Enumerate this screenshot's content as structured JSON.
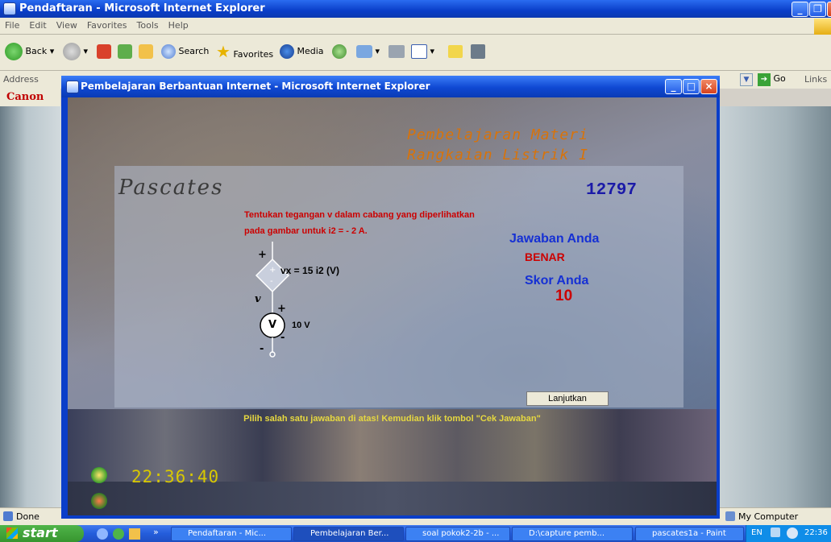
{
  "outer_window": {
    "title": "Pendaftaran - Microsoft Internet Explorer",
    "menu": [
      "File",
      "Edit",
      "View",
      "Favorites",
      "Tools",
      "Help"
    ],
    "toolbar": {
      "back": "Back",
      "search": "Search",
      "favorites": "Favorites",
      "media": "Media"
    },
    "address_label": "Address",
    "go_label": "Go",
    "links_label": "Links",
    "canon_label": "Canon",
    "status_left": "Done",
    "status_right": "My Computer"
  },
  "inner_window": {
    "title": "Pembelajaran Berbantuan Internet - Microsoft Internet Explorer",
    "heading_line1": "Pembelajaran Materi",
    "heading_line2": "Rangkaian Listrik I",
    "section_title": "Pascates",
    "user_number": "12797",
    "question_line1": "Tentukan tegangan v dalam cabang yang diperlihatkan",
    "question_line2": "pada gambar untuk i2 = - 2 A.",
    "circuit": {
      "dependent_source": "vx = 15 i2 (V)",
      "branch_voltage": "v",
      "source_value": "10 V",
      "plus_top": "+",
      "plus_mid": "+",
      "minus_mid": "-",
      "minus_bottom": "-",
      "source_symbol": "V"
    },
    "answer_label": "Jawaban Anda",
    "answer_value": "BENAR",
    "score_label": "Skor Anda",
    "score_value": "10",
    "next_button": "Lanjutkan",
    "instruction": "Pilih salah satu jawaban di atas! Kemudian klik tombol \"Cek Jawaban\"",
    "timer": "22:36:40"
  },
  "taskbar": {
    "start": "start",
    "tasks": [
      "Pendaftaran - Mic...",
      "Pembelajaran Ber...",
      "soal pokok2-2b - ...",
      "D:\\capture pemb...",
      "pascates1a - Paint"
    ],
    "lang": "EN",
    "clock": "22:36"
  },
  "colors": {
    "accent": "#d8730a",
    "score_blue": "#1b1aa8",
    "answer_red": "#cc0000",
    "label_blue": "#1530d4",
    "timer": "#d8c800"
  }
}
